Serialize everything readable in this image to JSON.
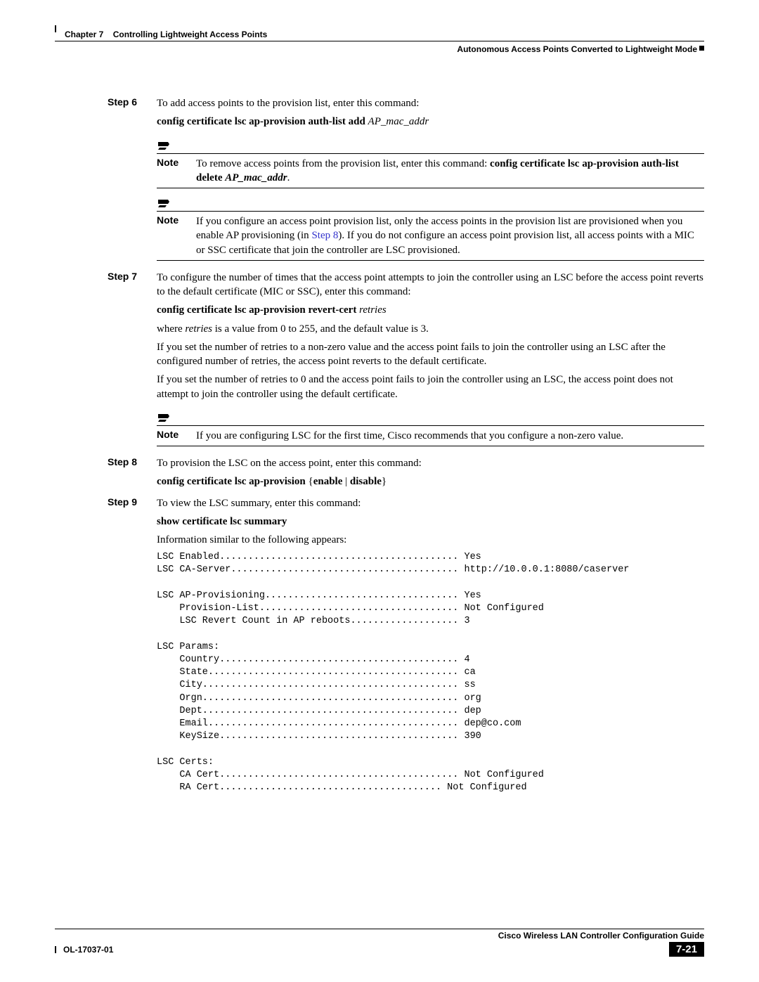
{
  "header": {
    "chapter_label": "Chapter 7",
    "chapter_title": "Controlling Lightweight Access Points",
    "section_title": "Autonomous Access Points Converted to Lightweight Mode"
  },
  "step6": {
    "label": "Step 6",
    "intro": "To add access points to the provision list, enter this command:",
    "cmd_bold": "config certificate lsc ap-provision auth-list add ",
    "cmd_italic": "AP_mac_addr"
  },
  "note1": {
    "label": "Note",
    "pre": "To remove access points from the provision list, enter this command: ",
    "cmd_bold1": "config certificate lsc ap-provision auth-list delete ",
    "cmd_italic": "AP_mac_addr",
    "post": "."
  },
  "note2": {
    "label": "Note",
    "pre": "If you configure an access point provision list, only the access points in the provision list are provisioned when you enable AP provisioning (in ",
    "link": "Step 8",
    "post": "). If you do not configure an access point provision list, all access points with a MIC or SSC certificate that join the controller are LSC provisioned."
  },
  "step7": {
    "label": "Step 7",
    "intro": "To configure the number of times that the access point attempts to join the controller using an LSC before the access point reverts to the default certificate (MIC or SSC), enter this command:",
    "cmd_bold": "config certificate lsc ap-provision revert-cert ",
    "cmd_italic": "retries",
    "where_pre": "where ",
    "where_italic": "retries",
    "where_post": " is a value from 0 to 255, and the default value is 3.",
    "para3": "If you set the number of retries to a non-zero value and the access point fails to join the controller using an LSC after the configured number of retries, the access point reverts to the default certificate.",
    "para4": "If you set the number of retries to 0 and the access point fails to join the controller using an LSC, the access point does not attempt to join the controller using the default certificate."
  },
  "note3": {
    "label": "Note",
    "text": "If you are configuring LSC for the first time, Cisco recommends that you configure a non-zero value."
  },
  "step8": {
    "label": "Step 8",
    "intro": "To provision the LSC on the access point, enter this command:",
    "cmd_bold": "config certificate lsc ap-provision ",
    "cmd_brace": "{",
    "cmd_opt1": "enable",
    "cmd_pipe": " | ",
    "cmd_opt2": "disable",
    "cmd_brace2": "}"
  },
  "step9": {
    "label": "Step 9",
    "intro": "To view the LSC summary, enter this command:",
    "cmd_bold": "show certificate lsc summary",
    "info": "Information similar to the following appears:",
    "output": "LSC Enabled.......................................... Yes\nLSC CA-Server........................................ http://10.0.0.1:8080/caserver\n\nLSC AP-Provisioning.................................. Yes\n    Provision-List................................... Not Configured\n    LSC Revert Count in AP reboots................... 3\n\nLSC Params:\n    Country.......................................... 4\n    State............................................ ca\n    City............................................. ss\n    Orgn............................................. org\n    Dept............................................. dep\n    Email............................................ dep@co.com\n    KeySize.......................................... 390\n\nLSC Certs:\n    CA Cert.......................................... Not Configured\n    RA Cert....................................... Not Configured"
  },
  "footer": {
    "guide": "Cisco Wireless LAN Controller Configuration Guide",
    "ol": "OL-17037-01",
    "page": "7-21"
  }
}
